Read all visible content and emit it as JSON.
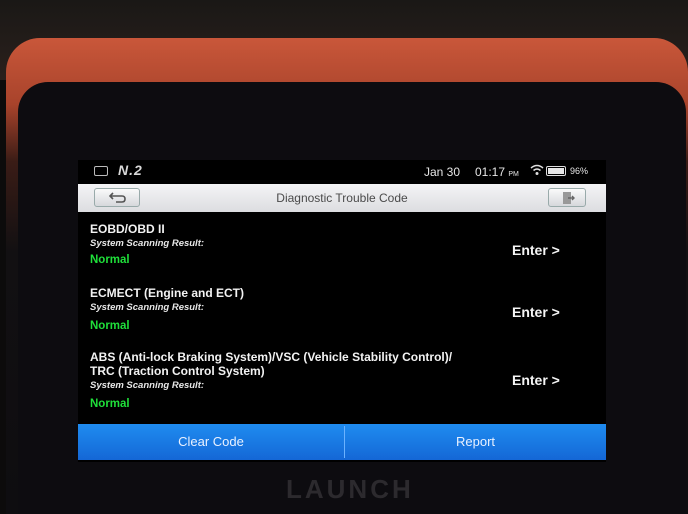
{
  "status_bar": {
    "version": "N.2",
    "date": "Jan 30",
    "time": "01:17",
    "ampm": "PM",
    "battery": "96%"
  },
  "header": {
    "title": "Diagnostic Trouble Code"
  },
  "systems": [
    {
      "name": "EOBD/OBD II",
      "result_label": "System Scanning Result:",
      "result": "Normal",
      "action": "Enter >"
    },
    {
      "name": "ECMECT (Engine and ECT)",
      "result_label": "System Scanning Result:",
      "result": "Normal",
      "action": "Enter >"
    },
    {
      "name_line1": "ABS (Anti-lock Braking System)/VSC (Vehicle Stability Control)/",
      "name_line2": "TRC (Traction Control System)",
      "result_label": "System Scanning Result:",
      "result": "Normal",
      "action": "Enter >"
    }
  ],
  "footer": {
    "clear_code": "Clear Code",
    "report": "Report"
  },
  "device": {
    "brand": "LAUNCH"
  },
  "colors": {
    "normal_status": "#1fe03a",
    "bottom_bar": "#1a7be6",
    "device_frame": "#c9573a"
  }
}
